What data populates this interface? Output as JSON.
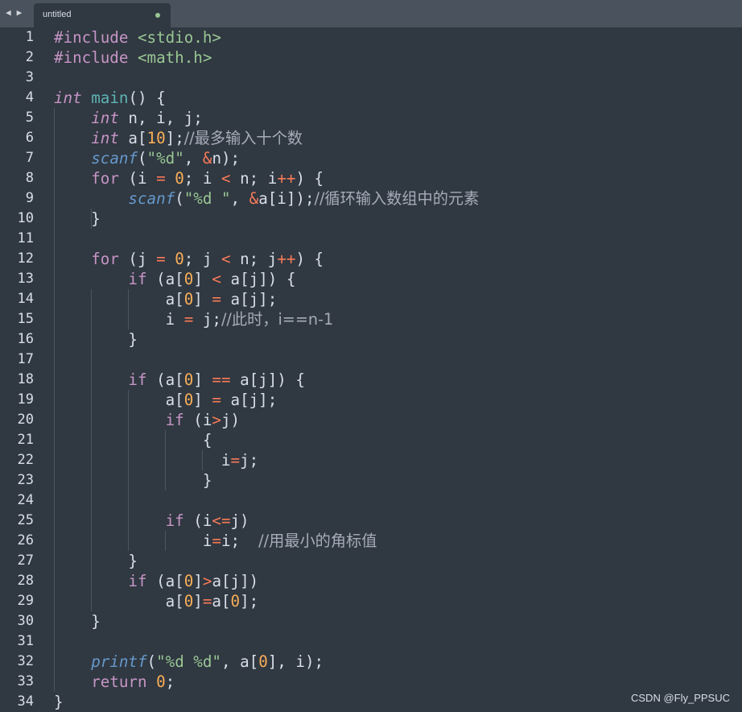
{
  "window": {
    "nav_back": "◀",
    "nav_forward": "▶",
    "tab_title": "untitled"
  },
  "colors": {
    "background": "#303841",
    "tabbar": "#4a525d",
    "keyword": "#c695c6",
    "function": "#6699cc",
    "string": "#99c794",
    "number": "#f9ae58",
    "operator": "#f97b58",
    "comment": "#a6acb9",
    "text": "#d8dee9"
  },
  "editor": {
    "lines": [
      {
        "num": "1",
        "tokens": [
          {
            "t": "#include ",
            "c": "k"
          },
          {
            "t": "<stdio.h>",
            "c": "s"
          }
        ]
      },
      {
        "num": "2",
        "tokens": [
          {
            "t": "#include ",
            "c": "k"
          },
          {
            "t": "<math.h>",
            "c": "s"
          }
        ]
      },
      {
        "num": "3",
        "tokens": []
      },
      {
        "num": "4",
        "tokens": [
          {
            "t": "int",
            "c": "t"
          },
          {
            "t": " ",
            "c": "p"
          },
          {
            "t": "main",
            "c": "fn"
          },
          {
            "t": "() {",
            "c": "p"
          }
        ]
      },
      {
        "num": "5",
        "tokens": [
          {
            "t": "    ",
            "c": "p"
          },
          {
            "t": "int",
            "c": "t"
          },
          {
            "t": " n, i, j;",
            "c": "p"
          }
        ]
      },
      {
        "num": "6",
        "tokens": [
          {
            "t": "    ",
            "c": "p"
          },
          {
            "t": "int",
            "c": "t"
          },
          {
            "t": " a[",
            "c": "p"
          },
          {
            "t": "10",
            "c": "n"
          },
          {
            "t": "];",
            "c": "p"
          },
          {
            "t": "//最多输入十个数",
            "c": "c"
          }
        ]
      },
      {
        "num": "7",
        "tokens": [
          {
            "t": "    ",
            "c": "p"
          },
          {
            "t": "scanf",
            "c": "f"
          },
          {
            "t": "(",
            "c": "p"
          },
          {
            "t": "\"%d\"",
            "c": "s"
          },
          {
            "t": ", ",
            "c": "p"
          },
          {
            "t": "&",
            "c": "o"
          },
          {
            "t": "n);",
            "c": "p"
          }
        ]
      },
      {
        "num": "8",
        "tokens": [
          {
            "t": "    ",
            "c": "p"
          },
          {
            "t": "for",
            "c": "k"
          },
          {
            "t": " (i ",
            "c": "p"
          },
          {
            "t": "=",
            "c": "o"
          },
          {
            "t": " ",
            "c": "p"
          },
          {
            "t": "0",
            "c": "n"
          },
          {
            "t": "; i ",
            "c": "p"
          },
          {
            "t": "<",
            "c": "o"
          },
          {
            "t": " n; i",
            "c": "p"
          },
          {
            "t": "++",
            "c": "o"
          },
          {
            "t": ") {",
            "c": "p"
          }
        ]
      },
      {
        "num": "9",
        "tokens": [
          {
            "t": "        ",
            "c": "p"
          },
          {
            "t": "scanf",
            "c": "f"
          },
          {
            "t": "(",
            "c": "p"
          },
          {
            "t": "\"%d \"",
            "c": "s"
          },
          {
            "t": ", ",
            "c": "p"
          },
          {
            "t": "&",
            "c": "o"
          },
          {
            "t": "a[i]);",
            "c": "p"
          },
          {
            "t": "//循环输入数组中的元素",
            "c": "c"
          }
        ]
      },
      {
        "num": "10",
        "tokens": [
          {
            "t": "    }",
            "c": "p"
          }
        ]
      },
      {
        "num": "11",
        "tokens": []
      },
      {
        "num": "12",
        "tokens": [
          {
            "t": "    ",
            "c": "p"
          },
          {
            "t": "for",
            "c": "k"
          },
          {
            "t": " (j ",
            "c": "p"
          },
          {
            "t": "=",
            "c": "o"
          },
          {
            "t": " ",
            "c": "p"
          },
          {
            "t": "0",
            "c": "n"
          },
          {
            "t": "; j ",
            "c": "p"
          },
          {
            "t": "<",
            "c": "o"
          },
          {
            "t": " n; j",
            "c": "p"
          },
          {
            "t": "++",
            "c": "o"
          },
          {
            "t": ") {",
            "c": "p"
          }
        ]
      },
      {
        "num": "13",
        "tokens": [
          {
            "t": "        ",
            "c": "p"
          },
          {
            "t": "if",
            "c": "k"
          },
          {
            "t": " (a[",
            "c": "p"
          },
          {
            "t": "0",
            "c": "n"
          },
          {
            "t": "] ",
            "c": "p"
          },
          {
            "t": "<",
            "c": "o"
          },
          {
            "t": " a[j]) {",
            "c": "p"
          }
        ]
      },
      {
        "num": "14",
        "tokens": [
          {
            "t": "            a[",
            "c": "p"
          },
          {
            "t": "0",
            "c": "n"
          },
          {
            "t": "] ",
            "c": "p"
          },
          {
            "t": "=",
            "c": "o"
          },
          {
            "t": " a[j];",
            "c": "p"
          }
        ]
      },
      {
        "num": "15",
        "tokens": [
          {
            "t": "            i ",
            "c": "p"
          },
          {
            "t": "=",
            "c": "o"
          },
          {
            "t": " j;",
            "c": "p"
          },
          {
            "t": "//此时，i==n-1",
            "c": "c"
          }
        ]
      },
      {
        "num": "16",
        "tokens": [
          {
            "t": "        }",
            "c": "p"
          }
        ]
      },
      {
        "num": "17",
        "tokens": []
      },
      {
        "num": "18",
        "tokens": [
          {
            "t": "        ",
            "c": "p"
          },
          {
            "t": "if",
            "c": "k"
          },
          {
            "t": " (a[",
            "c": "p"
          },
          {
            "t": "0",
            "c": "n"
          },
          {
            "t": "] ",
            "c": "p"
          },
          {
            "t": "==",
            "c": "o"
          },
          {
            "t": " a[j]) {",
            "c": "p"
          }
        ]
      },
      {
        "num": "19",
        "tokens": [
          {
            "t": "            a[",
            "c": "p"
          },
          {
            "t": "0",
            "c": "n"
          },
          {
            "t": "] ",
            "c": "p"
          },
          {
            "t": "=",
            "c": "o"
          },
          {
            "t": " a[j];",
            "c": "p"
          }
        ]
      },
      {
        "num": "20",
        "tokens": [
          {
            "t": "            ",
            "c": "p"
          },
          {
            "t": "if",
            "c": "k"
          },
          {
            "t": " (i",
            "c": "p"
          },
          {
            "t": ">",
            "c": "o"
          },
          {
            "t": "j)",
            "c": "p"
          }
        ]
      },
      {
        "num": "21",
        "tokens": [
          {
            "t": "                {",
            "c": "p"
          }
        ]
      },
      {
        "num": "22",
        "tokens": [
          {
            "t": "                  i",
            "c": "p"
          },
          {
            "t": "=",
            "c": "o"
          },
          {
            "t": "j;",
            "c": "p"
          }
        ]
      },
      {
        "num": "23",
        "tokens": [
          {
            "t": "                }",
            "c": "p"
          }
        ]
      },
      {
        "num": "24",
        "tokens": []
      },
      {
        "num": "25",
        "tokens": [
          {
            "t": "            ",
            "c": "p"
          },
          {
            "t": "if",
            "c": "k"
          },
          {
            "t": " (i",
            "c": "p"
          },
          {
            "t": "<=",
            "c": "o"
          },
          {
            "t": "j)",
            "c": "p"
          }
        ]
      },
      {
        "num": "26",
        "tokens": [
          {
            "t": "                i",
            "c": "p"
          },
          {
            "t": "=",
            "c": "o"
          },
          {
            "t": "i;  ",
            "c": "p"
          },
          {
            "t": "//用最小的角标值",
            "c": "c"
          }
        ]
      },
      {
        "num": "27",
        "tokens": [
          {
            "t": "        }",
            "c": "p"
          }
        ]
      },
      {
        "num": "28",
        "tokens": [
          {
            "t": "        ",
            "c": "p"
          },
          {
            "t": "if",
            "c": "k"
          },
          {
            "t": " (a[",
            "c": "p"
          },
          {
            "t": "0",
            "c": "n"
          },
          {
            "t": "]",
            "c": "p"
          },
          {
            "t": ">",
            "c": "o"
          },
          {
            "t": "a[j])",
            "c": "p"
          }
        ]
      },
      {
        "num": "29",
        "tokens": [
          {
            "t": "            a[",
            "c": "p"
          },
          {
            "t": "0",
            "c": "n"
          },
          {
            "t": "]",
            "c": "p"
          },
          {
            "t": "=",
            "c": "o"
          },
          {
            "t": "a[",
            "c": "p"
          },
          {
            "t": "0",
            "c": "n"
          },
          {
            "t": "];",
            "c": "p"
          }
        ]
      },
      {
        "num": "30",
        "tokens": [
          {
            "t": "    }",
            "c": "p"
          }
        ]
      },
      {
        "num": "31",
        "tokens": []
      },
      {
        "num": "32",
        "tokens": [
          {
            "t": "    ",
            "c": "p"
          },
          {
            "t": "printf",
            "c": "f"
          },
          {
            "t": "(",
            "c": "p"
          },
          {
            "t": "\"%d %d\"",
            "c": "s"
          },
          {
            "t": ", a[",
            "c": "p"
          },
          {
            "t": "0",
            "c": "n"
          },
          {
            "t": "], i);",
            "c": "p"
          }
        ]
      },
      {
        "num": "33",
        "tokens": [
          {
            "t": "    ",
            "c": "p"
          },
          {
            "t": "return",
            "c": "k"
          },
          {
            "t": " ",
            "c": "p"
          },
          {
            "t": "0",
            "c": "n"
          },
          {
            "t": ";",
            "c": "p"
          }
        ]
      },
      {
        "num": "34",
        "tokens": [
          {
            "t": "}",
            "c": "p"
          }
        ]
      }
    ]
  },
  "watermark": "CSDN @Fly_PPSUC"
}
